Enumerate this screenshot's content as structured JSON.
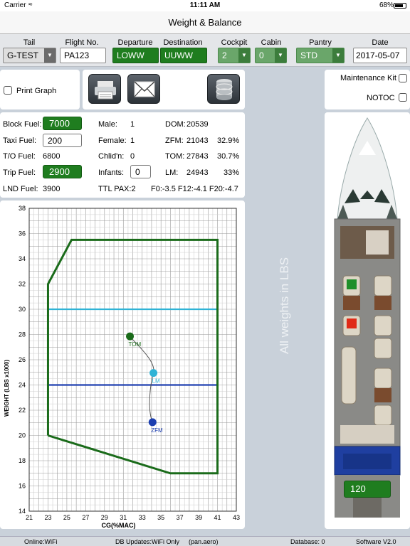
{
  "status_bar": {
    "carrier": "Carrier",
    "time": "11:11 AM",
    "battery": "68%"
  },
  "nav": {
    "title": "Weight & Balance"
  },
  "header": {
    "tail_label": "Tail",
    "tail_value": "G-TEST",
    "flight_label": "Flight No.",
    "flight_value": "PA123",
    "departure_label": "Departure",
    "departure_value": "LOWW",
    "destination_label": "Destination",
    "destination_value": "UUWW",
    "cockpit_label": "Cockpit",
    "cockpit_value": "2",
    "cabin_label": "Cabin",
    "cabin_value": "0",
    "pantry_label": "Pantry",
    "pantry_value": "STD",
    "date_label": "Date",
    "date_value": "2017-05-07"
  },
  "toolbar": {
    "print_graph_label": "Print Graph",
    "print_graph_checked": false
  },
  "options": {
    "maintenance_kit_label": "Maintenance Kit",
    "notoc_label": "NOTOC"
  },
  "fuel": {
    "block_label": "Block Fuel:",
    "block_value": "7000",
    "taxi_label": "Taxi Fuel:",
    "taxi_value": "200",
    "to_label": "T/O Fuel:",
    "to_value": "6800",
    "trip_label": "Trip Fuel:",
    "trip_value": "2900",
    "lnd_label": "LND Fuel:",
    "lnd_value": "3900"
  },
  "pax": {
    "male_label": "Male:",
    "male_value": "1",
    "female_label": "Female:",
    "female_value": "1",
    "child_label": "Chlid'n:",
    "child_value": "0",
    "infants_label": "Infants:",
    "infants_value": "0",
    "ttl_label": "TTL PAX:2"
  },
  "weights": {
    "dom_label": "DOM:",
    "dom_value": "20539",
    "zfm_label": "ZFM:",
    "zfm_value": "21043",
    "zfm_pct": "32.9%",
    "tom_label": "TOM:",
    "tom_value": "27843",
    "tom_pct": "30.7%",
    "lm_label": "LM:",
    "lm_value": "24943",
    "lm_pct": "33%",
    "f_values": "F0:-3.5  F12:-4.1  F20:-4.7"
  },
  "watermark": "All weights in LBS",
  "aircraft": {
    "baggage_value": "120"
  },
  "footer": {
    "online": "Online:WiFi",
    "db_updates": "DB Updates:WiFi Only",
    "domain": "(pan.aero)",
    "database": "Database:  0",
    "software": "Software V2.0"
  },
  "colors": {
    "accent_green": "#1f7d1f",
    "envelope": "#1a6b1a",
    "line_cyan": "#2fb3d6",
    "line_blue": "#1d3fb0"
  },
  "chart_data": {
    "type": "scatter",
    "xlabel": "CG(%MAC)",
    "ylabel": "WEIGHT (LBS x1000)",
    "xlim": [
      21,
      43
    ],
    "ylim": [
      14,
      38
    ],
    "xticks": [
      21,
      23,
      25,
      27,
      29,
      31,
      33,
      35,
      37,
      39,
      41,
      43
    ],
    "yticks": [
      14,
      16,
      18,
      20,
      22,
      24,
      26,
      28,
      30,
      32,
      34,
      36,
      38
    ],
    "grid": true,
    "envelope": {
      "x": [
        23,
        23,
        25.5,
        41,
        41,
        36,
        23
      ],
      "y": [
        20,
        32,
        35.5,
        35.5,
        17,
        17,
        20
      ]
    },
    "hlines": [
      {
        "y": 30,
        "x": [
          23,
          41
        ],
        "color": "#2fb3d6"
      },
      {
        "y": 24,
        "x": [
          23,
          41
        ],
        "color": "#1d3fb0"
      }
    ],
    "points": [
      {
        "name": "TOM",
        "x": 31.7,
        "y": 27.85,
        "color": "#1a6b1a"
      },
      {
        "name": "LM",
        "x": 34.2,
        "y": 24.95,
        "color": "#2fb3d6"
      },
      {
        "name": "ZFM",
        "x": 34.1,
        "y": 21.05,
        "color": "#1d3fb0"
      }
    ]
  }
}
